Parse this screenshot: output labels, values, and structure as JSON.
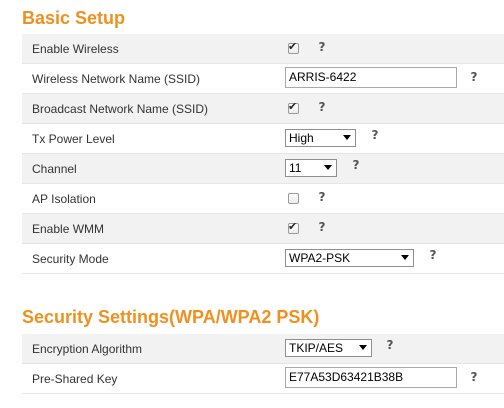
{
  "basic_setup": {
    "title": "Basic Setup",
    "enable_wireless": {
      "label": "Enable Wireless",
      "checked": true
    },
    "ssid": {
      "label": "Wireless Network Name (SSID)",
      "value": "ARRIS-6422"
    },
    "broadcast_ssid": {
      "label": "Broadcast Network Name (SSID)",
      "checked": true
    },
    "tx_power": {
      "label": "Tx Power Level",
      "value": "High"
    },
    "channel": {
      "label": "Channel",
      "value": "11"
    },
    "ap_isolation": {
      "label": "AP Isolation",
      "checked": false
    },
    "enable_wmm": {
      "label": "Enable WMM",
      "checked": true
    },
    "security_mode": {
      "label": "Security Mode",
      "value": "WPA2-PSK"
    }
  },
  "security_settings": {
    "title": "Security Settings(WPA/WPA2 PSK)",
    "encryption": {
      "label": "Encryption Algorithm",
      "value": "TKIP/AES"
    },
    "psk": {
      "label": "Pre-Shared Key",
      "value": "E77A53D63421B38B"
    }
  },
  "icons": {
    "help": "?",
    "check": "✔"
  },
  "colors": {
    "section_title": "#f0901e",
    "row_shade": "#f2f2f2"
  }
}
